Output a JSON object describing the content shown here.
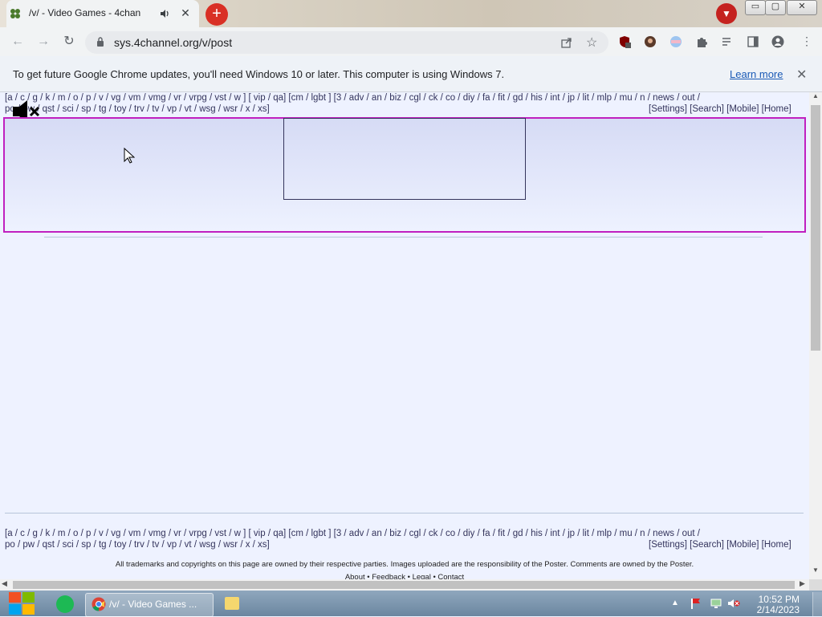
{
  "browser": {
    "tab_title": "/v/ - Video Games - 4chan",
    "tab_close": "✕",
    "new_tab": "+",
    "url": "sys.4channel.org/v/post",
    "window_buttons": {
      "minimize": "▭",
      "maximize": "▢",
      "close": "✕"
    }
  },
  "infobar": {
    "message": "To get future Google Chrome updates, you'll need Windows 10 or later. This computer is using Windows 7.",
    "learn_more": "Learn more",
    "close": "✕"
  },
  "boardnav": {
    "line1": "[a / c / g / k / m / o / p / v / vg / vm / vmg / vr / vrpg / vst / w ] [ vip / qa] [cm / lgbt ] [3 / adv / an / biz / cgl / ck / co / diy / fa / fit / gd / his / int / jp / lit / mlp / mu / n / news / out /",
    "line2": "po / pw / qst / sci / sp / tg / toy / trv / tv / vp / vt / wsg / wsr / x / xs]",
    "right": "[Settings] [Search] [Mobile] [Home]",
    "bottom_line1": "[a / c / g / k / m / o / p / v / vg / vm / vmg / vr / vrpg / vst / w ] [ vip / qa] [cm / lgbt ] [3 / adv / an / biz / cgl / ck / co / diy / fa / fit / gd / his / int / jp / lit / mlp / mu / n / news / out /",
    "bottom_line2": "po / pw / qst / sci / sp / tg / toy / trv / tv / vp / vt / wsg / wsr / x / xs]",
    "bottom_right": "[Settings] [Search] [Mobile] [Home]"
  },
  "footer": {
    "disclaimer": "All trademarks and copyrights on this page are owned by their respective parties. Images uploaded are the responsibility of the Poster. Comments are owned by the Poster.",
    "links": "About • Feedback • Legal • Contact"
  },
  "taskbar": {
    "chrome_label": "/v/ - Video Games ...",
    "time": "10:52 PM",
    "date": "2/14/2023",
    "tray_expand": "▲"
  },
  "colors": {
    "page_bg": "#eef2ff",
    "banner_border": "#c020c0",
    "nav_text": "#34345c",
    "link": "#1a5ab6",
    "new_tab_button": "#d93025"
  },
  "icons": [
    "tab-favicon-icon",
    "tab-audio-icon",
    "back-icon",
    "forward-icon",
    "reload-icon",
    "lock-icon",
    "share-icon",
    "star-icon",
    "ublock-icon",
    "profile-avatar-icon",
    "extension-icon",
    "puzzle-icon",
    "reading-list-icon",
    "side-panel-icon",
    "account-icon",
    "menu-icon",
    "mute-icon",
    "cursor-icon",
    "windows-start-icon",
    "spotify-icon",
    "chrome-icon",
    "explorer-icon",
    "flag-icon",
    "network-icon",
    "volume-muted-icon"
  ]
}
